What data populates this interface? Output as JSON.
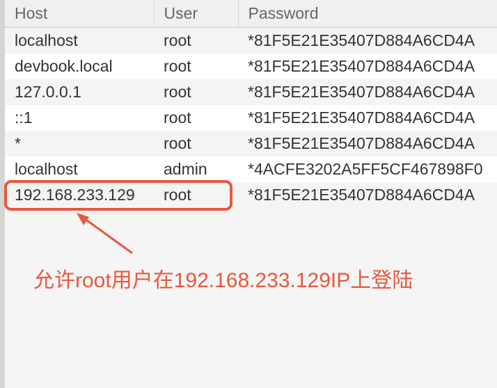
{
  "headers": {
    "host": "Host",
    "user": "User",
    "password": "Password"
  },
  "rows": [
    {
      "host": "localhost",
      "user": "root",
      "password": "*81F5E21E35407D884A6CD4A"
    },
    {
      "host": "devbook.local",
      "user": "root",
      "password": "*81F5E21E35407D884A6CD4A"
    },
    {
      "host": "127.0.0.1",
      "user": "root",
      "password": "*81F5E21E35407D884A6CD4A"
    },
    {
      "host": "::1",
      "user": "root",
      "password": "*81F5E21E35407D884A6CD4A"
    },
    {
      "host": "*",
      "user": "root",
      "password": "*81F5E21E35407D884A6CD4A"
    },
    {
      "host": "localhost",
      "user": "admin",
      "password": "*4ACFE3202A5FF5CF467898F0"
    },
    {
      "host": "192.168.233.129",
      "user": "root",
      "password": "*81F5E21E35407D884A6CD4A"
    }
  ],
  "annotation": "允许root用户在192.168.233.129IP上登陆",
  "colors": {
    "highlight": "#e8583c"
  }
}
